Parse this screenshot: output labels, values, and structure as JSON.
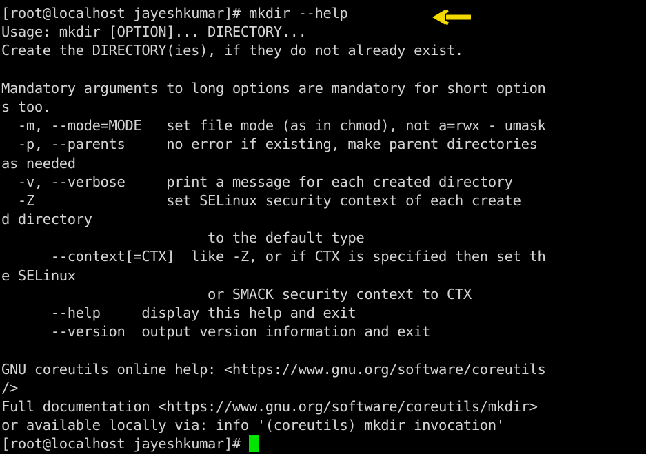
{
  "terminal": {
    "prompt": "[root@localhost jayeshkumar]#",
    "command": "mkdir --help",
    "foreground_color": "#d4d4d4",
    "background_color": "#000000",
    "cursor_color": "#00e400",
    "annotation_arrow_color": "#f2d900",
    "lines": [
      "[root@localhost jayeshkumar]# mkdir --help",
      "Usage: mkdir [OPTION]... DIRECTORY...",
      "Create the DIRECTORY(ies), if they do not already exist.",
      "",
      "Mandatory arguments to long options are mandatory for short option",
      "s too.",
      "  -m, --mode=MODE   set file mode (as in chmod), not a=rwx - umask",
      "  -p, --parents     no error if existing, make parent directories",
      "as needed",
      "  -v, --verbose     print a message for each created directory",
      "  -Z                set SELinux security context of each create",
      "d directory",
      "                         to the default type",
      "      --context[=CTX]  like -Z, or if CTX is specified then set th",
      "e SELinux",
      "                         or SMACK security context to CTX",
      "      --help     display this help and exit",
      "      --version  output version information and exit",
      "",
      "GNU coreutils online help: <https://www.gnu.org/software/coreutils",
      "/>",
      "Full documentation <https://www.gnu.org/software/coreutils/mkdir>",
      "or available locally via: info '(coreutils) mkdir invocation'"
    ],
    "final_prompt": "[root@localhost jayeshkumar]# "
  }
}
